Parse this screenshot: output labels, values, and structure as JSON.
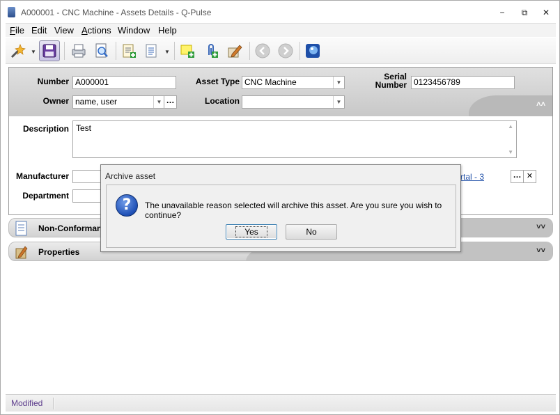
{
  "window": {
    "title": "A000001 - CNC Machine - Assets Details - Q-Pulse",
    "minimize": "−",
    "maximize": "⧉",
    "close": "✕"
  },
  "menu": {
    "items": [
      {
        "label": "File",
        "u": "F",
        "rest": "ile"
      },
      {
        "label": "Edit",
        "u": "",
        "rest": "Edit"
      },
      {
        "label": "View",
        "u": "",
        "rest": "View"
      },
      {
        "label": "Actions",
        "u": "A",
        "rest": "ctions"
      },
      {
        "label": "Window",
        "u": "",
        "rest": "Window"
      },
      {
        "label": "Help",
        "u": "",
        "rest": "Help"
      }
    ]
  },
  "toolbar": {
    "icons": [
      "wand-icon",
      "save-icon",
      "print-icon",
      "print-preview-icon",
      "add-document-icon",
      "document-list-icon",
      "new-note-icon",
      "attach-icon",
      "edit-icon",
      "back-icon",
      "forward-icon",
      "globe-icon"
    ]
  },
  "details": {
    "number_label": "Number",
    "number_value": "A000001",
    "asset_type_label": "Asset Type",
    "asset_type_value": "CNC Machine",
    "serial_label_line1": "Serial",
    "serial_label_line2": "Number",
    "serial_value": "0123456789",
    "owner_label": "Owner",
    "owner_value": "name, user",
    "location_label": "Location",
    "location_value": "",
    "description_label": "Description",
    "description_value": "Test",
    "manufacturer_label": "Manufacturer",
    "manufacturer_value": "",
    "department_label": "Department",
    "department_value": "",
    "partial_link": "rtal - 3",
    "ellipsis": "…",
    "clear": "✕",
    "collapse": "˄˄"
  },
  "sections": [
    {
      "title": "Non-Conformanc",
      "expand": "˅˅"
    },
    {
      "title": "Properties",
      "expand": "˅˅"
    }
  ],
  "status": {
    "text": "Modified"
  },
  "dialog": {
    "title": "Archive asset",
    "icon": "?",
    "message": "The unavailable reason selected will archive this asset. Are you sure you wish to continue?",
    "yes_label": "Yes",
    "no_label": "No"
  },
  "colors": {
    "status_text": "#5c3c8c",
    "link": "#1f4fa8",
    "question_icon": "#1e4fb5"
  }
}
